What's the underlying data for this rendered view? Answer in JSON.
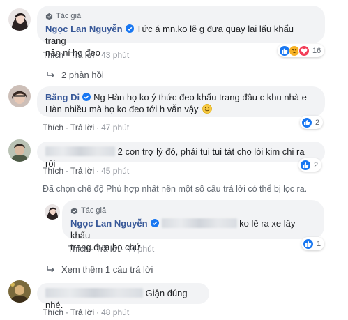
{
  "labels": {
    "author_badge": "Tác giả",
    "like": "Thích",
    "reply": "Trả lời"
  },
  "comments": [
    {
      "author": "Ngọc Lan Nguyễn",
      "badge": "Tác giả",
      "text_l1": "Tức á mn.ko lẽ g đưa quay lại lấu khẩu trang",
      "text_l2": "năn nỉ họ đeo",
      "time": "43 phút",
      "reaction_count": "16"
    },
    {
      "author": "Băng Di",
      "text_l1": "Ng Hàn họ ko ý thức đeo khẩu trang đâu c khu nhà e",
      "text_l2": "Hàn nhiều mà họ ko đeo tới h vẫn vậy",
      "time": "47 phút",
      "reaction_count": "2"
    },
    {
      "text_l1": "2 con trợ lý đó, phải tui tui tát cho lòi kim chi ra rồi",
      "time": "45 phút",
      "reaction_count": "2"
    },
    {
      "author": "Ngọc Lan Nguyễn",
      "badge": "Tác giả",
      "text_l1": "ko lẽ ra xe lấy khẩu",
      "text_l2": "trang đưa họ chứ.",
      "time": "44 phút",
      "reaction_count": "1"
    },
    {
      "text_l1": "Giận đúng nhé.",
      "time": "48 phút"
    }
  ],
  "replies_toggle": "2 phản hồi",
  "filter_note": "Đã chọn chế độ Phù hợp nhất nên một số câu trả lời có thể bị lọc ra.",
  "view_more": "Xem thêm 1 câu trả lời",
  "colors": {
    "name": "#385898",
    "bubble": "#f2f3f5",
    "like_blue": "#1877f2",
    "love_red": "#f33e58",
    "haha_yellow": "#f7b125"
  },
  "icons": [
    "author-badge-icon",
    "verified-icon",
    "like-icon",
    "haha-icon",
    "love-icon",
    "reply-arrow-icon",
    "smiley-emoji-icon"
  ]
}
